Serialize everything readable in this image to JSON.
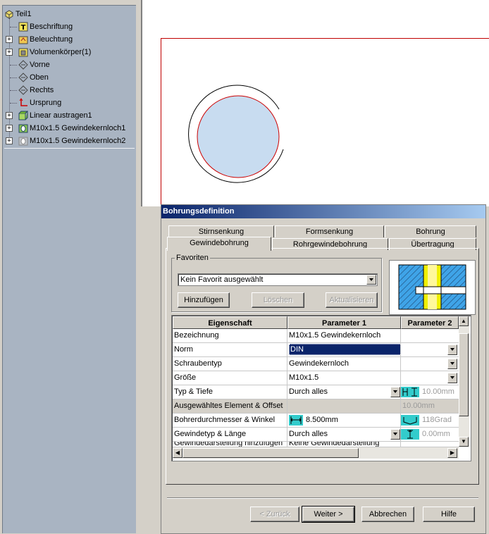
{
  "tree": {
    "items": [
      {
        "label": "Teil1",
        "icon": "part-icon"
      },
      {
        "label": "Beschriftung",
        "icon": "annotation-icon"
      },
      {
        "label": "Beleuchtung",
        "icon": "lighting-icon"
      },
      {
        "label": "Volumenkörper(1)",
        "icon": "solid-body-icon"
      },
      {
        "label": "Vorne",
        "icon": "plane-icon"
      },
      {
        "label": "Oben",
        "icon": "plane-icon"
      },
      {
        "label": "Rechts",
        "icon": "plane-icon"
      },
      {
        "label": "Ursprung",
        "icon": "origin-icon"
      },
      {
        "label": "Linear austragen1",
        "icon": "extrude-icon"
      },
      {
        "label": "M10x1.5 Gewindekernloch1",
        "icon": "hole-icon"
      },
      {
        "label": "M10x1.5 Gewindekernloch2",
        "icon": "hole-icon"
      }
    ]
  },
  "dialog": {
    "title": "Bohrungsdefinition",
    "tabs_row1": [
      "Stirnsenkung",
      "Formsenkung",
      "Bohrung"
    ],
    "tabs_row2": [
      "Gewindebohrung",
      "Rohrgewindebohrung",
      "Übertragung"
    ],
    "active_tab": "Gewindebohrung",
    "favorites": {
      "group_label": "Favoriten",
      "selected": "Kein Favorit ausgewählt",
      "add_label": "Hinzufügen",
      "delete_label": "Löschen",
      "update_label": "Aktualisieren"
    },
    "grid": {
      "headers": [
        "Eigenschaft",
        "Parameter 1",
        "Parameter 2"
      ],
      "rows": [
        {
          "prop": "Bezeichnung",
          "p1": "M10x1.5 Gewindekernloch",
          "p2": ""
        },
        {
          "prop": "Norm",
          "p1": "DIN",
          "p2": ""
        },
        {
          "prop": "Schraubentyp",
          "p1": "Gewindekernloch",
          "p2": ""
        },
        {
          "prop": "Größe",
          "p1": "M10x1.5",
          "p2": ""
        },
        {
          "prop": "Typ & Tiefe",
          "p1": "Durch alles",
          "p2": "10.00mm"
        },
        {
          "prop": "Ausgewähltes Element & Offset",
          "p1": "",
          "p2": "10.00mm"
        },
        {
          "prop": "Bohrerdurchmesser & Winkel",
          "p1": "8.500mm",
          "p2": "118Grad"
        },
        {
          "prop": "Gewindetyp & Länge",
          "p1": "Durch alles",
          "p2": "0.00mm"
        },
        {
          "prop": "Gewindedarstellung hinzufügen",
          "p1": "Keine Gewindedarstellung",
          "p2": ""
        }
      ]
    },
    "buttons": {
      "back": "< Zurück",
      "next": "Weiter >",
      "cancel": "Abbrechen",
      "help": "Hilfe"
    }
  },
  "colors": {
    "tree_bg": "#a9b4c2",
    "title_start": "#0a246a",
    "title_end": "#a6caf0",
    "sketch_red": "#cc0000",
    "face_blue": "#c8dcf0",
    "preview_blue": "#3fa4e8",
    "preview_yellow": "#f0f000",
    "icon_cyan": "#33cccc"
  }
}
